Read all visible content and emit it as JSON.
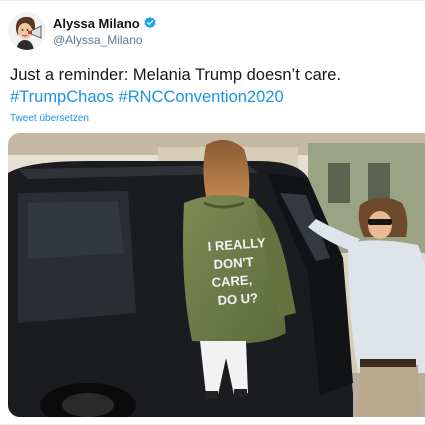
{
  "tweet": {
    "author": {
      "display_name": "Alyssa Milano",
      "handle": "@Alyssa_Milano",
      "verified": true,
      "verified_icon": "verified-badge-icon",
      "avatar_icon": "cartoon-avatar-with-megaphone"
    },
    "text": {
      "plain": "Just a reminder: Melania Trump doesn’t care.",
      "hashtags": [
        "#TrumpChaos",
        "#RNCConvention2020"
      ]
    },
    "translate_label": "Tweet übersetzen",
    "media": {
      "jacket_text_line1": "I REALLY",
      "jacket_text_line2": "DON'T",
      "jacket_text_line3": "CARE,",
      "jacket_text_line4": "DO U?"
    }
  },
  "colors": {
    "link": "#1b95e0",
    "text": "#14171a",
    "secondary": "#657786",
    "verified": "#1da1f2"
  }
}
